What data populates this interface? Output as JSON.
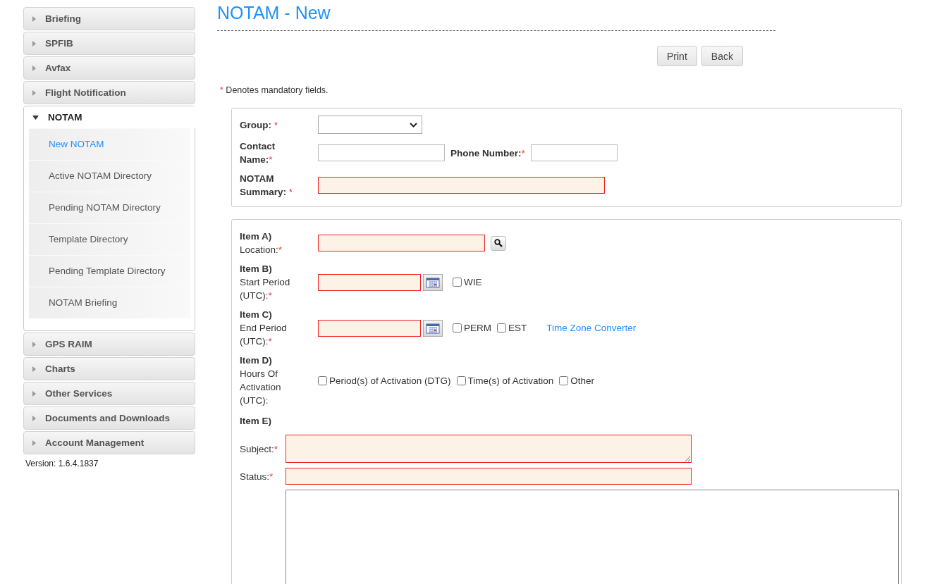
{
  "sidebar": {
    "sections": [
      {
        "label": "Briefing",
        "expanded": false
      },
      {
        "label": "SPFIB",
        "expanded": false
      },
      {
        "label": "Avfax",
        "expanded": false
      },
      {
        "label": "Flight Notification",
        "expanded": false
      },
      {
        "label": "NOTAM",
        "expanded": true,
        "items": [
          {
            "label": "New NOTAM",
            "selected": true
          },
          {
            "label": "Active NOTAM Directory",
            "selected": false
          },
          {
            "label": "Pending NOTAM Directory",
            "selected": false
          },
          {
            "label": "Template Directory",
            "selected": false
          },
          {
            "label": "Pending Template Directory",
            "selected": false
          },
          {
            "label": "NOTAM Briefing",
            "selected": false
          }
        ]
      },
      {
        "label": "GPS RAIM",
        "expanded": false
      },
      {
        "label": "Charts",
        "expanded": false
      },
      {
        "label": "Other Services",
        "expanded": false
      },
      {
        "label": "Documents and Downloads",
        "expanded": false
      },
      {
        "label": "Account Management",
        "expanded": false
      }
    ],
    "version": "Version: 1.6.4.1837"
  },
  "page": {
    "title": "NOTAM - New",
    "buttons": [
      "Print",
      "Back"
    ],
    "mandatory_note": {
      "mark": "*",
      "text": "Denotes mandatory fields."
    }
  },
  "header_form": {
    "group": {
      "label": "Group:",
      "mark": "*"
    },
    "contact_name": {
      "label": "Contact Name:",
      "mark": "*",
      "invalid": false
    },
    "phone_number": {
      "label": "Phone Number:",
      "mark": "*",
      "invalid": false
    },
    "summary": {
      "label": "NOTAM Summary:",
      "mark": "*",
      "invalid": true
    }
  },
  "items_form": {
    "item_a": {
      "item": "Item A)",
      "label": "Location:",
      "mark": "*",
      "invalid": true
    },
    "item_b": {
      "item": "Item B)",
      "label": "Start Period (UTC):",
      "mark": "*",
      "invalid": true,
      "checkboxes": [
        {
          "label": "WIE",
          "checked": false
        }
      ]
    },
    "item_c": {
      "item": "Item C)",
      "label": "End Period (UTC):",
      "mark": "*",
      "invalid": true,
      "checkboxes": [
        {
          "label": "PERM",
          "checked": false
        },
        {
          "label": "EST",
          "checked": false
        }
      ],
      "link": "Time Zone Converter"
    },
    "item_d": {
      "item": "Item D)",
      "label": "Hours Of Activation (UTC):",
      "checkboxes": [
        {
          "label": "Period(s) of Activation (DTG)",
          "checked": false
        },
        {
          "label": "Time(s) of Activation",
          "checked": false
        },
        {
          "label": "Other",
          "checked": false
        }
      ]
    },
    "item_e": {
      "item": "Item E)",
      "subject": {
        "label": "Subject:",
        "mark": "*",
        "invalid": true
      },
      "status": {
        "label": "Status:",
        "mark": "*",
        "invalid": true
      },
      "text": {
        "invalid": false
      }
    }
  }
}
